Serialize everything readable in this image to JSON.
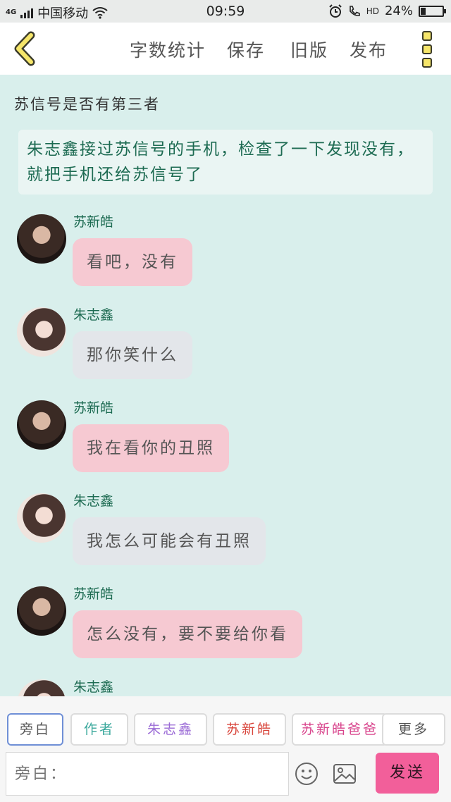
{
  "status_bar": {
    "network": "4G",
    "carrier": "中国移动",
    "time": "09:59",
    "hd_label": "HD",
    "battery": "24%",
    "battery_level": 0.24
  },
  "toolbar": {
    "items": [
      "字数统计",
      "保存",
      "旧版",
      "发布"
    ]
  },
  "chat": {
    "chapter_title": "苏信号是否有第三者",
    "narration": "朱志鑫接过苏信号的手机，检查了一下发现没有，就把手机还给苏信号了",
    "messages": [
      {
        "speaker": "苏新皓",
        "text": "看吧，没有"
      },
      {
        "speaker": "朱志鑫",
        "text": "那你笑什么"
      },
      {
        "speaker": "苏新皓",
        "text": "我在看你的丑照"
      },
      {
        "speaker": "朱志鑫",
        "text": "我怎么可能会有丑照"
      },
      {
        "speaker": "苏新皓",
        "text": "怎么没有，要不要给你看"
      },
      {
        "speaker": "朱志鑫",
        "text": ""
      }
    ]
  },
  "composer": {
    "chips": [
      "旁白",
      "作者",
      "朱志鑫",
      "苏新皓",
      "苏新皓爸爸",
      "更多"
    ],
    "chip_colors": [
      "#555555",
      "#3aa89c",
      "#9b6bd6",
      "#d8443a",
      "#d8448c",
      "#555555"
    ],
    "input_placeholder": "旁白：",
    "send_label": "发送",
    "colors": {
      "send": "#f25f9a",
      "bubble_a": "#f6c9d2",
      "bubble_b": "#e3e6ea",
      "speaker": "#1d6b52"
    }
  }
}
